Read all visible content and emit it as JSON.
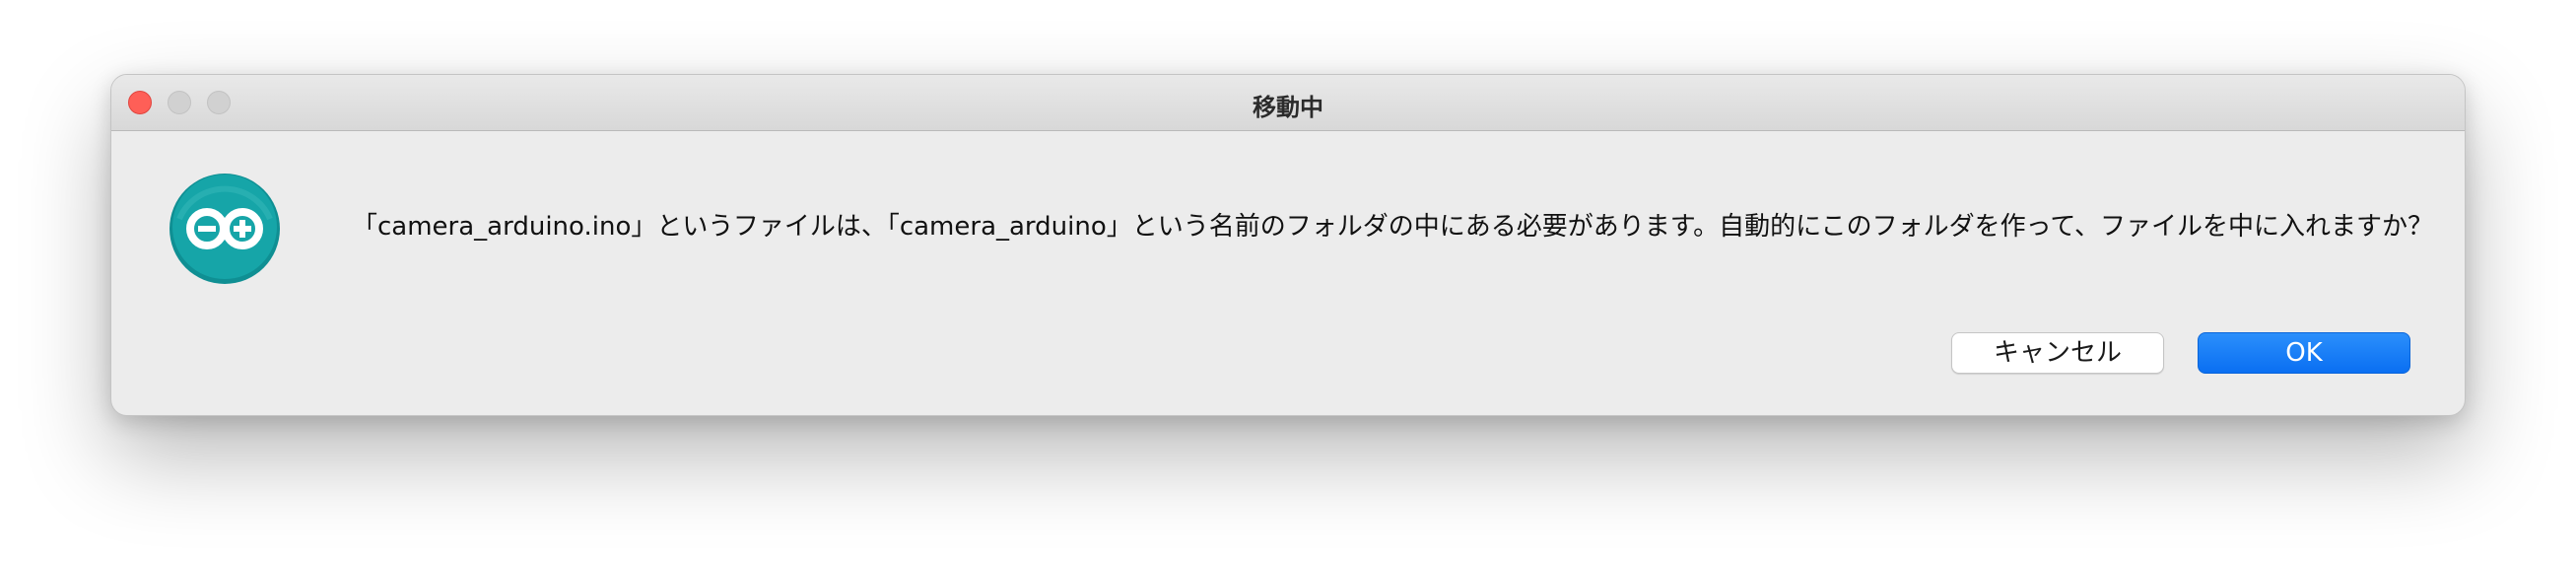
{
  "window": {
    "title": "移動中"
  },
  "dialog": {
    "message": "「camera_arduino.ino」というファイルは、「camera_arduino」という名前のフォルダの中にある必要があります。自動的にこのフォルダを作って、ファイルを中に入れますか？",
    "icon": "arduino-logo-icon"
  },
  "buttons": {
    "cancel_label": "キャンセル",
    "ok_label": "OK"
  },
  "colors": {
    "accent": "#0a6ff2",
    "icon_teal": "#16a5a8",
    "close_button": "#fe5f57"
  }
}
